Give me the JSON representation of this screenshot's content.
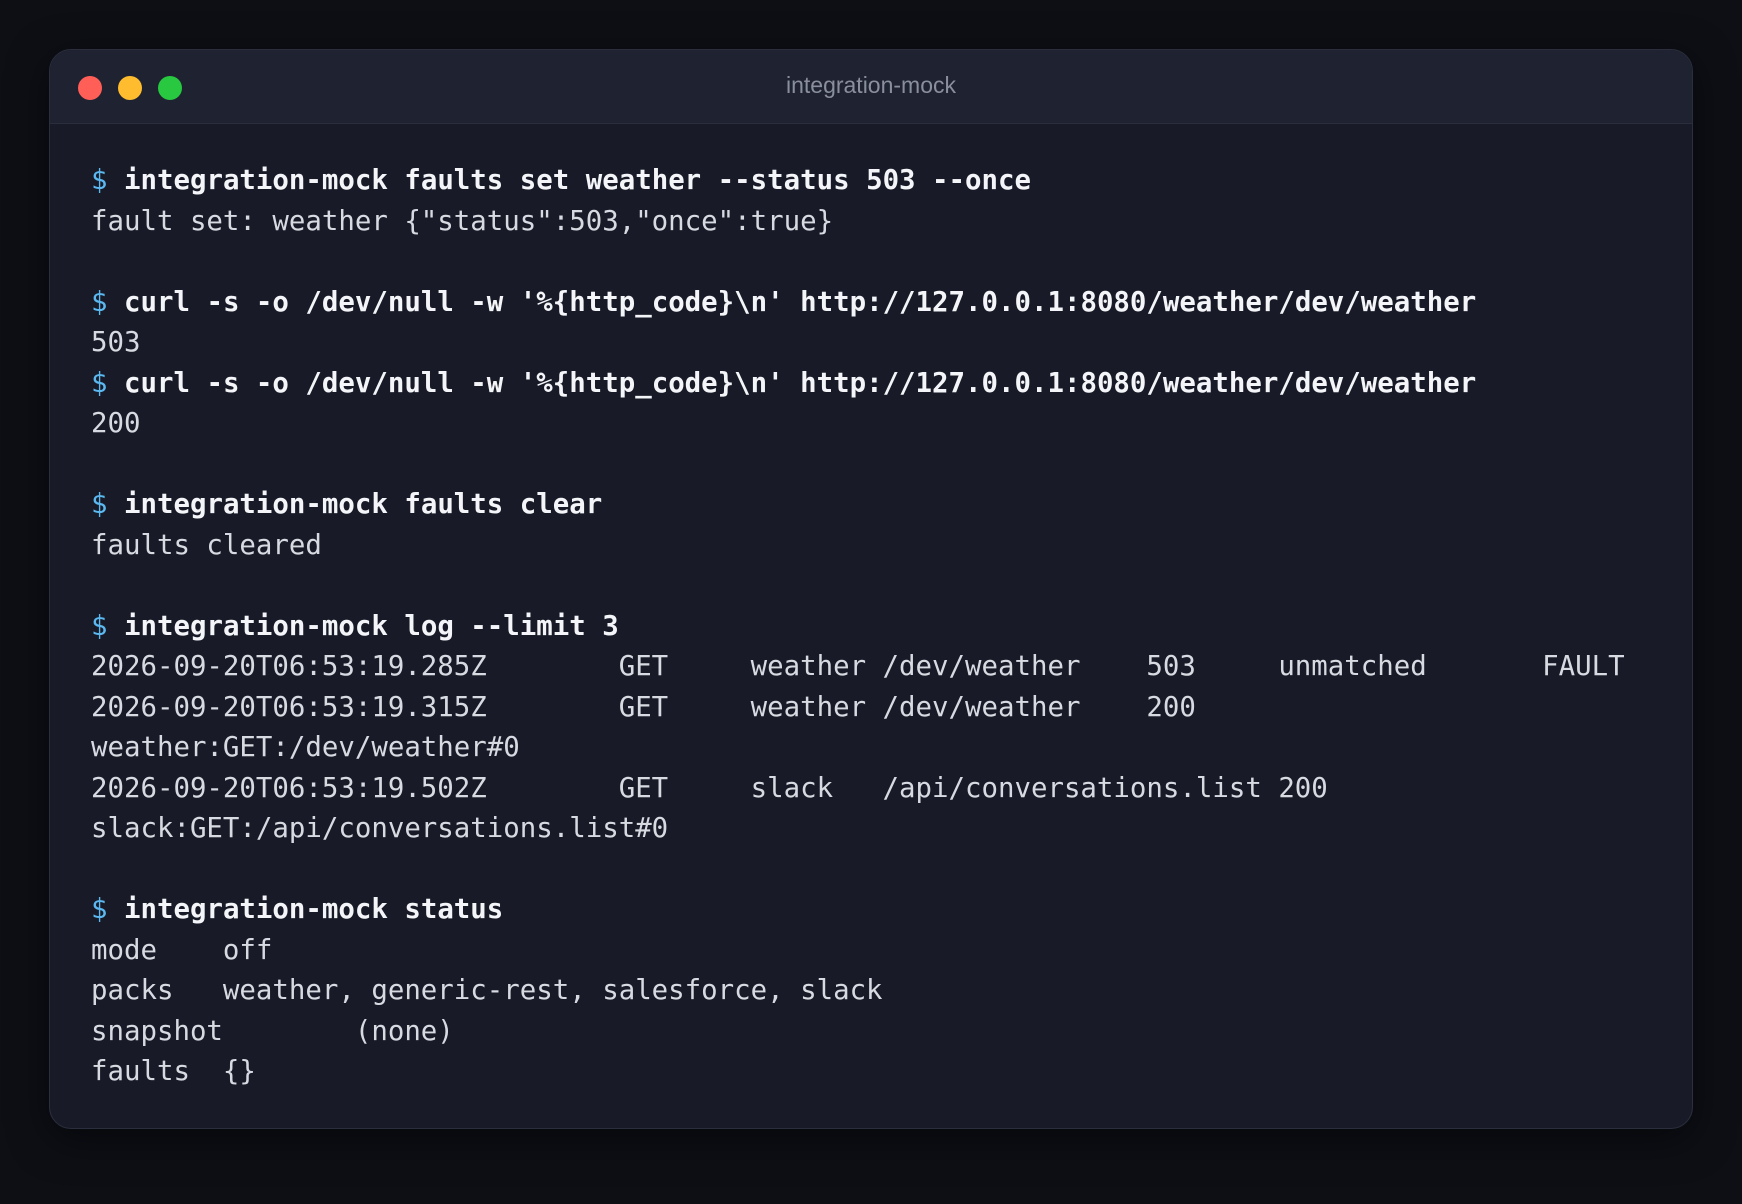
{
  "window": {
    "title": "integration-mock"
  },
  "prompt_symbol": "$",
  "blocks": [
    {
      "command": "integration-mock faults set weather --status 503 --once",
      "output": [
        "fault set: weather {\"status\":503,\"once\":true}"
      ]
    },
    {
      "command": "curl -s -o /dev/null -w '%{http_code}\\n' http://127.0.0.1:8080/weather/dev/weather",
      "output": [
        "503"
      ]
    },
    {
      "command": "curl -s -o /dev/null -w '%{http_code}\\n' http://127.0.0.1:8080/weather/dev/weather",
      "output": [
        "200"
      ]
    },
    {
      "command": "integration-mock faults clear",
      "output": [
        "faults cleared"
      ]
    },
    {
      "command": "integration-mock log --limit 3",
      "output": [
        "2026-09-20T06:53:19.285Z        GET     weather /dev/weather    503     unmatched       FAULT",
        "2026-09-20T06:53:19.315Z        GET     weather /dev/weather    200",
        "weather:GET:/dev/weather#0",
        "2026-09-20T06:53:19.502Z        GET     slack   /api/conversations.list 200",
        "slack:GET:/api/conversations.list#0"
      ]
    },
    {
      "command": "integration-mock status",
      "output": [
        "mode    off",
        "packs   weather, generic-rest, salesforce, slack",
        "snapshot        (none)",
        "faults  {}"
      ]
    }
  ],
  "colors": {
    "prompt": "#5cb8f0",
    "command": "#f4f5f8",
    "output": "#d8dae2",
    "background": "#181b27",
    "titlebar": "#1e2231",
    "close": "#ff5f57",
    "minimize": "#febc2e",
    "maximize": "#28c840"
  }
}
